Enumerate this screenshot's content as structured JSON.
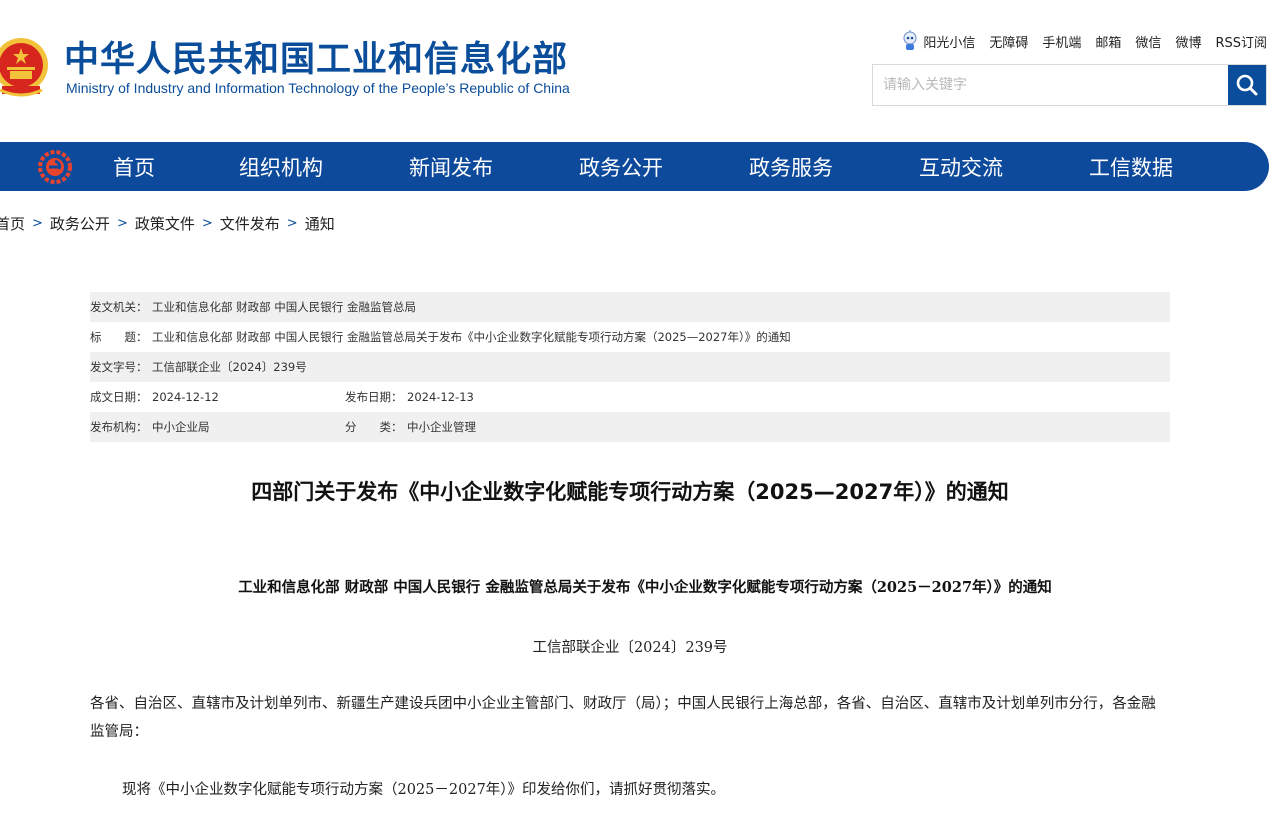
{
  "header": {
    "title": "中华人民共和国工业和信息化部",
    "subtitle": "Ministry of Industry and Information Technology of the People’s Republic of China",
    "top_links": [
      "阳光小信",
      "无障碍",
      "手机端",
      "邮箱",
      "微信",
      "微博",
      "RSS订阅"
    ],
    "search_placeholder": "请输入关键字"
  },
  "nav": {
    "items": [
      "首页",
      "组织机构",
      "新闻发布",
      "政务公开",
      "政务服务",
      "互动交流",
      "工信数据"
    ]
  },
  "breadcrumb": [
    "首页",
    "政务公开",
    "政策文件",
    "文件发布",
    "通知"
  ],
  "meta": {
    "issuer_label": "发文机关：",
    "issuer": "工业和信息化部 财政部 中国人民银行 金融监管总局",
    "title_label": "标　　题：",
    "title": "工业和信息化部 财政部 中国人民银行 金融监管总局关于发布《中小企业数字化赋能专项行动方案（2025—2027年）》的通知",
    "docno_label": "发文字号：",
    "docno": "工信部联企业〔2024〕239号",
    "created_label": "成文日期：",
    "created": "2024-12-12",
    "published_label": "发布日期：",
    "published": "2024-12-13",
    "org_label": "发布机构：",
    "org": "中小企业局",
    "category_label": "分　　类：",
    "category": "中小企业管理"
  },
  "article": {
    "title": "四部门关于发布《中小企业数字化赋能专项行动方案（2025—2027年）》的通知",
    "subtitle": "工业和信息化部 财政部 中国人民银行 金融监管总局关于发布《中小企业数字化赋能专项行动方案（2025－2027年）》的通知",
    "doc_no": "工信部联企业〔2024〕239号",
    "addressee": "各省、自治区、直辖市及计划单列市、新疆生产建设兵团中小企业主管部门、财政厅（局）；中国人民银行上海总部，各省、自治区、直辖市及计划单列市分行，各金融监管局：",
    "paragraph1": "现将《中小企业数字化赋能专项行动方案（2025－2027年）》印发给你们，请抓好贯彻落实。"
  },
  "colors": {
    "brand": "#0e4a9b",
    "emblem_red": "#d7261e",
    "emblem_gold": "#f2c23b"
  },
  "icons": [
    "national-emblem-icon",
    "robot-mascot-icon",
    "search-icon",
    "miit-logo-icon"
  ]
}
